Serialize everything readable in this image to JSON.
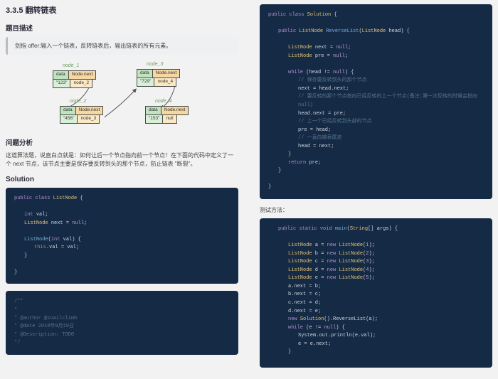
{
  "section": {
    "number": "3.3.5",
    "title": "翻转链表"
  },
  "headings": {
    "desc": "题目描述",
    "analysis": "问题分析",
    "solution": "Solution",
    "test": "测试方法："
  },
  "callout_text": "剑指 offer:输入一个链表，反转链表后，输出链表的所有元素。",
  "diagram": {
    "labels": {
      "n1": "node_1",
      "n2": "node_2",
      "n3": "node_3",
      "n4": "node_4"
    },
    "header": {
      "data": "data",
      "next": "Node.next"
    },
    "row": {
      "data_lbl": "data",
      "next_lbl": "Node.next"
    },
    "vals": {
      "n1": "\"123\"",
      "n1n": "node_2",
      "n3h": "\"729\"",
      "n3n": "node_4",
      "n2": "\"456\"",
      "n2n": "node_3",
      "n4": "\"153\"",
      "n4n": "null"
    }
  },
  "analysis_text": "这道算法题，说直白点就是：如何让后一个节点指向前一个节点！在下面的代码中定义了一个 next 节点，该节点主要是保存要反转到头的那个节点，防止链表 \"断裂\"。",
  "code1": {
    "l1a": "public",
    "l1b": "class",
    "l1c": "ListNode",
    "l2a": "int",
    "l2b": "val;",
    "l3a": "ListNode",
    "l3b": "next =",
    "l3c": "null",
    "l4a": "ListNode",
    "l4b": "int",
    "l4c": "val) {",
    "l5a": "this",
    "l5b": ".val = val;"
  },
  "code2": {
    "c1": "/**",
    "c2": " *",
    "c3": " * @author @snailclimb",
    "c4": " * @date 2018年9月19日",
    "c5": " * @Description: TODO",
    "c6": " */"
  },
  "code3": {
    "l1a": "public",
    "l1b": "class",
    "l1c": "Solution",
    "l2a": "public",
    "l2b": "ListNode",
    "l2c": "ReverseList",
    "l2d": "ListNode",
    "l2e": "head) {",
    "l3a": "ListNode",
    "l3b": "next =",
    "l3c": "null",
    "l4a": "ListNode",
    "l4b": "pre =",
    "l4c": "null",
    "l5a": "while",
    "l5b": "(head !=",
    "l5c": "null",
    "l5d": ") {",
    "c1": "// 保存要反转到头的那个节点",
    "l6": "next = head.next;",
    "c2": "// 要反转的那个节点指向已经反转的上一个节点(备注:第一次反转的时候会指向null)",
    "l7": "head.next = pre;",
    "c3": "// 上一个已经反转到头部的节点",
    "l8": "pre = head;",
    "c4": "// 一直向链表尾走",
    "l9": "head = next;",
    "l10a": "return",
    "l10b": "pre;"
  },
  "code4": {
    "l1a": "public",
    "l1b": "static",
    "l1c": "void",
    "l1d": "main",
    "l1e": "String",
    "l1f": "[] args) {",
    "la": "ListNode",
    "lb": "a =",
    "lc": "new",
    "ld": "ListNode",
    "le": "1",
    "m2": "ListNode b = new ListNode(2);",
    "m3": "ListNode c = new ListNode(3);",
    "m4": "ListNode d = new ListNode(4);",
    "m5": "ListNode e = new ListNode(5);",
    "n1": "a.next = b;",
    "n2": "b.next = c;",
    "n3": "c.next = d;",
    "n4": "d.next = e;",
    "r1": "new",
    "r2": "Solution",
    "r3": "().ReverseList(a);",
    "w1": "while",
    "w2": "(e !=",
    "w3": "null",
    "w4": ") {",
    "p1": "System.out.println(e.val);",
    "p2": "e = e.next;"
  }
}
